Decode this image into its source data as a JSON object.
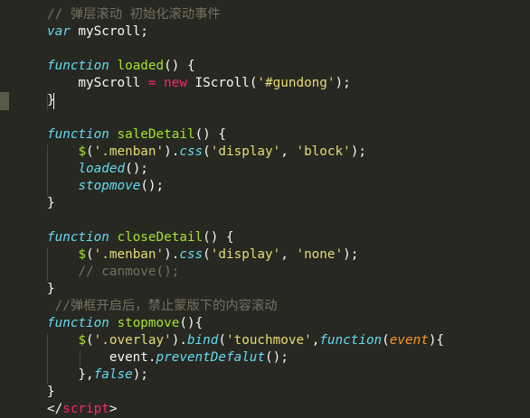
{
  "editor": {
    "background": "#272822",
    "colors": {
      "keyword": "#66d9ef",
      "function": "#a6e22e",
      "operator": "#f92672",
      "string": "#e6db74",
      "comment": "#75715e",
      "plain": "#f8f8f2",
      "parameter": "#fd971f"
    },
    "lines": [
      [
        {
          "t": "// 弹层滚动 初始化滚动事件",
          "c": "cm"
        }
      ],
      [
        {
          "t": "var",
          "c": "kw"
        },
        {
          "t": " myScroll;",
          "c": "pl"
        }
      ],
      [],
      [
        {
          "t": "function",
          "c": "kw"
        },
        {
          "t": " ",
          "c": "pl"
        },
        {
          "t": "loaded",
          "c": "fn"
        },
        {
          "t": "() {",
          "c": "pl"
        }
      ],
      [
        {
          "t": "    myScroll ",
          "c": "pl"
        },
        {
          "t": "=",
          "c": "op"
        },
        {
          "t": " ",
          "c": "pl"
        },
        {
          "t": "new",
          "c": "op"
        },
        {
          "t": " IScroll(",
          "c": "pl"
        },
        {
          "t": "'#gundong'",
          "c": "str"
        },
        {
          "t": ");",
          "c": "pl"
        }
      ],
      [
        {
          "t": "}",
          "c": "pl"
        }
      ],
      [],
      [
        {
          "t": "function",
          "c": "kw"
        },
        {
          "t": " ",
          "c": "pl"
        },
        {
          "t": "saleDetail",
          "c": "fn"
        },
        {
          "t": "() {",
          "c": "pl"
        }
      ],
      [
        {
          "t": "    ",
          "c": "pl"
        },
        {
          "t": "$",
          "c": "fn"
        },
        {
          "t": "(",
          "c": "pl"
        },
        {
          "t": "'.menban'",
          "c": "str"
        },
        {
          "t": ").",
          "c": "pl"
        },
        {
          "t": "css",
          "c": "kw"
        },
        {
          "t": "(",
          "c": "pl"
        },
        {
          "t": "'display'",
          "c": "str"
        },
        {
          "t": ", ",
          "c": "pl"
        },
        {
          "t": "'block'",
          "c": "str"
        },
        {
          "t": ");",
          "c": "pl"
        }
      ],
      [
        {
          "t": "    ",
          "c": "pl"
        },
        {
          "t": "loaded",
          "c": "kw"
        },
        {
          "t": "();",
          "c": "pl"
        }
      ],
      [
        {
          "t": "    ",
          "c": "pl"
        },
        {
          "t": "stopmove",
          "c": "kw"
        },
        {
          "t": "();",
          "c": "pl"
        }
      ],
      [
        {
          "t": "}",
          "c": "pl"
        }
      ],
      [],
      [
        {
          "t": "function",
          "c": "kw"
        },
        {
          "t": " ",
          "c": "pl"
        },
        {
          "t": "closeDetail",
          "c": "fn"
        },
        {
          "t": "() {",
          "c": "pl"
        }
      ],
      [
        {
          "t": "    ",
          "c": "pl"
        },
        {
          "t": "$",
          "c": "fn"
        },
        {
          "t": "(",
          "c": "pl"
        },
        {
          "t": "'.menban'",
          "c": "str"
        },
        {
          "t": ").",
          "c": "pl"
        },
        {
          "t": "css",
          "c": "kw"
        },
        {
          "t": "(",
          "c": "pl"
        },
        {
          "t": "'display'",
          "c": "str"
        },
        {
          "t": ", ",
          "c": "pl"
        },
        {
          "t": "'none'",
          "c": "str"
        },
        {
          "t": ");",
          "c": "pl"
        }
      ],
      [
        {
          "t": "    // canmove();",
          "c": "cm"
        }
      ],
      [
        {
          "t": "}",
          "c": "pl"
        }
      ],
      [
        {
          "t": " //弹框开启后，禁止蒙版下的内容滚动",
          "c": "cm"
        }
      ],
      [
        {
          "t": "function",
          "c": "kw"
        },
        {
          "t": " ",
          "c": "pl"
        },
        {
          "t": "stopmove",
          "c": "fn"
        },
        {
          "t": "(){",
          "c": "pl"
        }
      ],
      [
        {
          "t": "    ",
          "c": "pl"
        },
        {
          "t": "$",
          "c": "fn"
        },
        {
          "t": "(",
          "c": "pl"
        },
        {
          "t": "'.overlay'",
          "c": "str"
        },
        {
          "t": ").",
          "c": "pl"
        },
        {
          "t": "bind",
          "c": "kw"
        },
        {
          "t": "(",
          "c": "pl"
        },
        {
          "t": "'touchmove'",
          "c": "str"
        },
        {
          "t": ",",
          "c": "pl"
        },
        {
          "t": "function",
          "c": "kw"
        },
        {
          "t": "(",
          "c": "pl"
        },
        {
          "t": "event",
          "c": "param"
        },
        {
          "t": "){",
          "c": "pl"
        }
      ],
      [
        {
          "t": "        event.",
          "c": "pl"
        },
        {
          "t": "preventDefalut",
          "c": "kw"
        },
        {
          "t": "();",
          "c": "pl"
        }
      ],
      [
        {
          "t": "    },",
          "c": "pl"
        },
        {
          "t": "false",
          "c": "kw"
        },
        {
          "t": ");",
          "c": "pl"
        }
      ],
      [
        {
          "t": "}",
          "c": "pl"
        }
      ],
      [
        {
          "t": "</",
          "c": "pl"
        },
        {
          "t": "script",
          "c": "tag"
        },
        {
          "t": ">",
          "c": "pl"
        }
      ]
    ]
  }
}
